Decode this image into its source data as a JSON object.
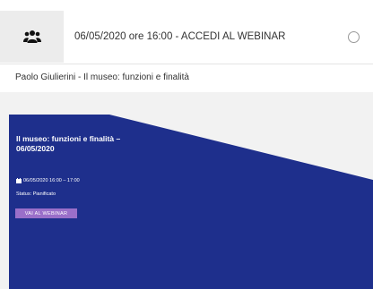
{
  "lesson": {
    "title": "06/05/2020 ore 16:00 - ACCEDI AL WEBINAR",
    "subtitle": "Paolo Giulierini - Il museo: funzioni e finalità",
    "icon": "users-icon"
  },
  "banner": {
    "title": "Il museo: funzioni e finalità – 06/05/2020",
    "date": "06/05/2020 16:00 – 17:00",
    "status": "Status: Pianificato",
    "button_label": "VAI AL WEBINAR",
    "colors": {
      "background": "#1e2f8c",
      "background_light": "#ffffff",
      "button": "#9a6fc9"
    }
  }
}
